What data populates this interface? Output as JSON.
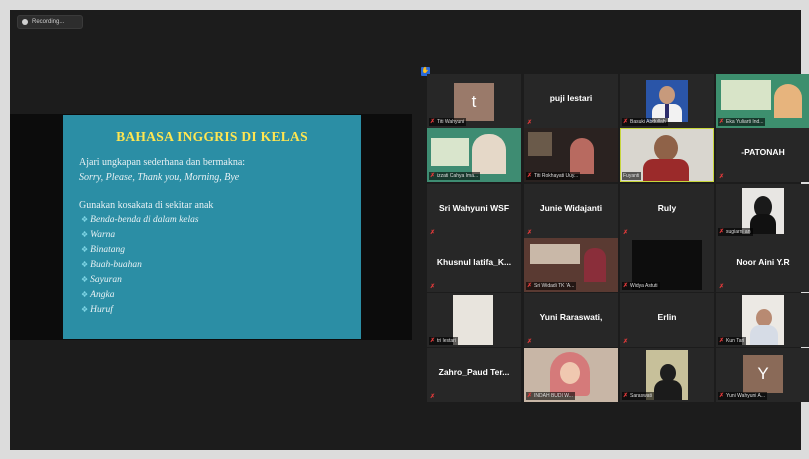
{
  "recording": {
    "label": "Recording..."
  },
  "slide": {
    "title": "BAHASA  INGGRIS DI KELAS",
    "line1": "Ajari ungkapan sederhana dan bermakna:",
    "line2": "Sorry, Please, Thank you, Morning, Bye",
    "line3": "Gunakan kosakata di sekitar anak",
    "bullet_glyph": "❖",
    "bullets": [
      "Benda-benda di dalam kelas",
      "Warna",
      "Binatang",
      "Buah-buahan",
      "Sayuran",
      "Angka",
      "Huruf"
    ]
  },
  "gallery": {
    "hand_icon": "hand-icon",
    "tiles": [
      {
        "name": "",
        "label": "Titi Wahyuni",
        "letter": "t",
        "letter_color": "#9a7a6a"
      },
      {
        "name": "puji lestari",
        "label": ""
      },
      {
        "name": "",
        "label": "Basuki Abdullah"
      },
      {
        "name": "",
        "label": "Eka Yuliarti Ind..."
      },
      {
        "name": "",
        "label": "izzati Cahya Ima..."
      },
      {
        "name": "",
        "label": "Titi Rokhayati Uuy..."
      },
      {
        "name": "",
        "label": "Fuyanti"
      },
      {
        "name": "-PATONAH",
        "label": ""
      },
      {
        "name": "Sri Wahyuni WSF",
        "label": ""
      },
      {
        "name": "Junie Widajanti",
        "label": ""
      },
      {
        "name": "Ruly",
        "label": ""
      },
      {
        "name": "",
        "label": "sugiarni an"
      },
      {
        "name": "Khusnul latifa_K...",
        "label": ""
      },
      {
        "name": "",
        "label": "Sri Widadi TK 'A..."
      },
      {
        "name": "",
        "label": "Widya Astuti"
      },
      {
        "name": "Noor Aini Y.R",
        "label": ""
      },
      {
        "name": "",
        "label": "tri lestari"
      },
      {
        "name": "Yuni Raraswati,",
        "label": ""
      },
      {
        "name": "Erlin",
        "label": ""
      },
      {
        "name": "",
        "label": "Kun Tari"
      },
      {
        "name": "Zahro_Paud Ter...",
        "label": ""
      },
      {
        "name": "",
        "label": "INDAH BUDI W..."
      },
      {
        "name": "",
        "label": "Saraswati"
      },
      {
        "name": "",
        "label": "Yuni Wahyuni A...",
        "letter": "Y",
        "letter_color": "#8a6a58"
      }
    ]
  }
}
